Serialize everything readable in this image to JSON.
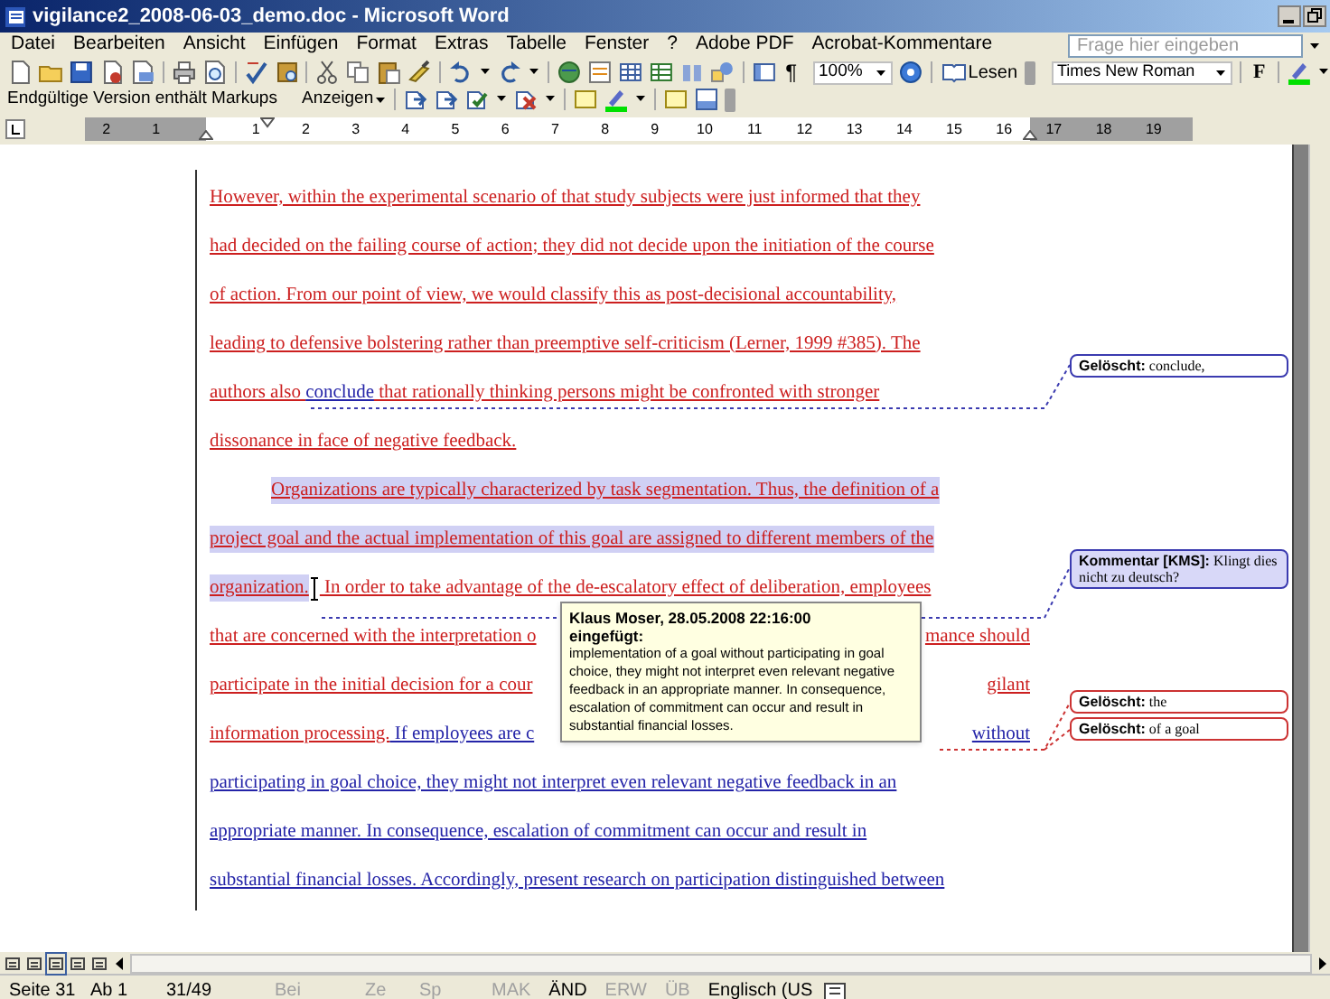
{
  "window": {
    "title": "vigilance2_2008-06-03_demo.doc - Microsoft Word"
  },
  "menu": {
    "items": [
      "Datei",
      "Bearbeiten",
      "Ansicht",
      "Einfügen",
      "Format",
      "Extras",
      "Tabelle",
      "Fenster",
      "?",
      "Adobe PDF",
      "Acrobat-Kommentare"
    ],
    "help_box": {
      "placeholder": "Frage hier eingeben"
    }
  },
  "standard_toolbar": {
    "formatting_marks": "¶",
    "zoom": "100%",
    "read_button": "Lesen",
    "font": "Times New Roman",
    "bold_button": "F"
  },
  "review_toolbar": {
    "display_mode": "Endgültige Version enthält Markups",
    "show_menu": "Anzeigen"
  },
  "ruler": {
    "labels": [
      "2",
      "1",
      "1",
      "2",
      "3",
      "4",
      "5",
      "6",
      "7",
      "8",
      "9",
      "10",
      "11",
      "12",
      "13",
      "14",
      "15",
      "16",
      "17",
      "18",
      "19"
    ]
  },
  "document": {
    "lines": [
      {
        "segments": [
          {
            "text": "However, within the experimental scenario of that study subjects were just informed that they",
            "color": "#cc1f1f"
          }
        ]
      },
      {
        "segments": [
          {
            "text": "had decided on the failing course of action; they did not decide upon the initiation of the course",
            "color": "#cc1f1f"
          }
        ]
      },
      {
        "segments": [
          {
            "text": "of action. From our point of view, we would classify this as post-decisional accountability,",
            "color": "#cc1f1f"
          }
        ]
      },
      {
        "segments": [
          {
            "text": "leading to defensive bolstering rather than preemptive self-criticism (Lerner, 1999 #385). The",
            "color": "#cc1f1f"
          }
        ]
      },
      {
        "segments": [
          {
            "text": "authors also ",
            "color": "#cc1f1f"
          },
          {
            "text": "conclude",
            "color": "#2424a8"
          },
          {
            "text": " that rationally thinking persons might be confronted with stronger",
            "color": "#cc1f1f"
          }
        ]
      },
      {
        "segments": [
          {
            "text": "dissonance in face of negative feedback.",
            "color": "#cc1f1f"
          }
        ]
      },
      {
        "indented": true,
        "segments": [
          {
            "text": "Organizations are typically characterized by task segmentation. Thus, the definition of a",
            "color": "#cc1f1f",
            "commented": true
          }
        ]
      },
      {
        "segments": [
          {
            "text": "project goal and the actual implementation of this goal are assigned to different members of the",
            "color": "#cc1f1f",
            "commented": true
          }
        ]
      },
      {
        "segments": [
          {
            "text": "organization.",
            "color": "#cc1f1f",
            "commented": true
          },
          {
            "kind": "cursor"
          },
          {
            "text": " In order to take advantage of the de-escalatory effect of deliberation, employees",
            "color": "#cc1f1f"
          }
        ]
      },
      {
        "segments": [
          {
            "text": "that are concerned with the interpretation o",
            "color": "#cc1f1f"
          }
        ],
        "after_tooltip": [
          {
            "text": "mance should",
            "color": "#cc1f1f"
          }
        ]
      },
      {
        "segments": [
          {
            "text": "participate in the initial decision for a cour",
            "color": "#cc1f1f"
          }
        ],
        "after_tooltip": [
          {
            "text": "gilant",
            "color": "#cc1f1f"
          }
        ]
      },
      {
        "segments": [
          {
            "text": "information processing.",
            "color": "#cc1f1f"
          },
          {
            "text": " If employees are c",
            "color": "#2424a8"
          }
        ],
        "after_tooltip": [
          {
            "text": "without",
            "color": "#2424a8"
          }
        ]
      },
      {
        "segments": [
          {
            "text": "participating in goal choice, they might not interpret even relevant negative feedback in an",
            "color": "#2424a8"
          }
        ]
      },
      {
        "segments": [
          {
            "text": "appropriate manner. In consequence, escalation of commitment can occur and result in",
            "color": "#2424a8"
          }
        ]
      },
      {
        "segments": [
          {
            "text": "substantial financial losses. Accordingly, present research on participation distinguished between",
            "color": "#2424a8"
          }
        ]
      }
    ]
  },
  "balloons": [
    {
      "kind": "deletion",
      "label": "Gelöscht:",
      "text": "conclude,",
      "color": "#3b3bb0"
    },
    {
      "kind": "comment",
      "label": "Kommentar [KMS]:",
      "text": "Klingt dies nicht zu deutsch?",
      "color": "#3b3bb0"
    },
    {
      "kind": "deletion",
      "label": "Gelöscht:",
      "text": "the",
      "color": "#cc3333"
    },
    {
      "kind": "deletion",
      "label": "Gelöscht:",
      "text": "of a goal",
      "color": "#cc3333"
    }
  ],
  "tooltip": {
    "header": "Klaus Moser, 28.05.2008 22:16:00",
    "action": "eingefügt:",
    "text": "implementation of a goal without participating in goal choice, they might not interpret even relevant negative feedback in an appropriate manner. In consequence, escalation of commitment can occur and result in substantial financial losses."
  },
  "status_bar": {
    "page": "Seite 31",
    "section": "Ab 1",
    "pages": "31/49",
    "position_fields": [
      {
        "text": "Bei",
        "disabled": true
      },
      {
        "text": "Ze",
        "disabled": true
      },
      {
        "text": "Sp",
        "disabled": true
      }
    ],
    "indicators": [
      {
        "text": "MAK",
        "on": false
      },
      {
        "text": "ÄND",
        "on": true
      },
      {
        "text": "ERW",
        "on": false
      },
      {
        "text": "ÜB",
        "on": false
      }
    ],
    "language": "Englisch (US"
  }
}
